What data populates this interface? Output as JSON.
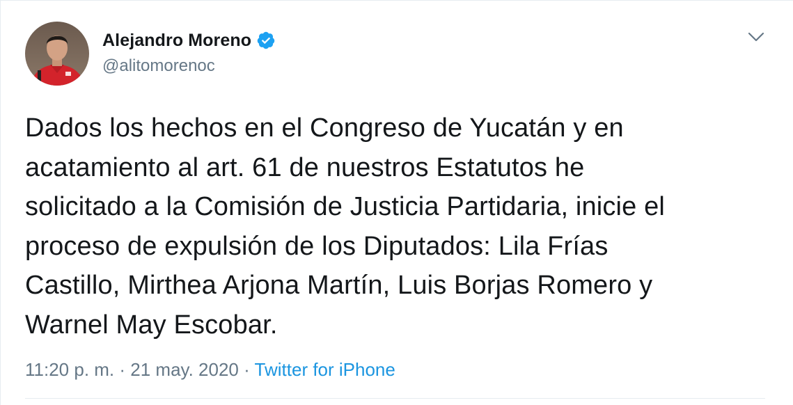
{
  "author": {
    "name": "Alejandro Moreno",
    "handle": "@alitomorenoc",
    "verified": true,
    "verified_icon": "verified-badge-icon",
    "avatar_icon": "profile-photo"
  },
  "menu": {
    "icon": "chevron-down-icon"
  },
  "tweet": {
    "text": "Dados los hechos en el Congreso de Yucatán y en\nacatamiento al art. 61 de nuestros Estatutos he\nsolicitado a la Comisión de Justicia Partidaria, inicie el\nproceso de expulsión de los Diputados: Lila Frías\nCastillo, Mirthea Arjona Martín, Luis Borjas Romero y\nWarnel May Escobar."
  },
  "meta": {
    "time": "11:20 p. m.",
    "separator1": " · ",
    "date": "21 may. 2020",
    "separator2": " · ",
    "source": "Twitter for iPhone"
  },
  "colors": {
    "text_primary": "#14171a",
    "text_secondary": "#657786",
    "link": "#1b95e0",
    "verified": "#1da1f2",
    "border": "#e6ecf0"
  }
}
